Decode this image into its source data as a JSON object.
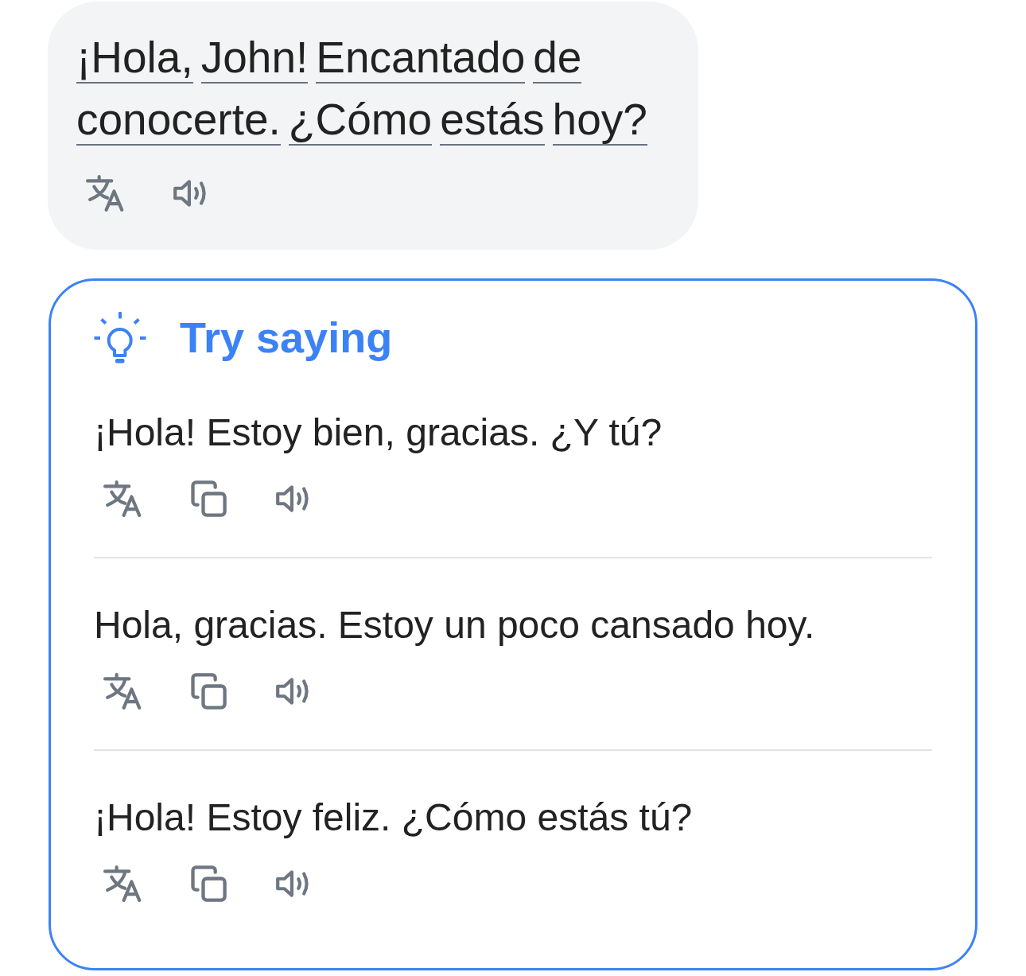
{
  "message": {
    "words": [
      "¡Hola,",
      "John!",
      "Encantado",
      "de",
      "conocerte.",
      "¿Cómo",
      "estás",
      "hoy?"
    ]
  },
  "suggestions": {
    "title": "Try saying",
    "items": [
      {
        "text": "¡Hola! Estoy bien, gracias. ¿Y tú?"
      },
      {
        "text": "Hola, gracias. Estoy un poco cansado hoy."
      },
      {
        "text": "¡Hola! Estoy feliz. ¿Cómo estás tú?"
      }
    ]
  }
}
